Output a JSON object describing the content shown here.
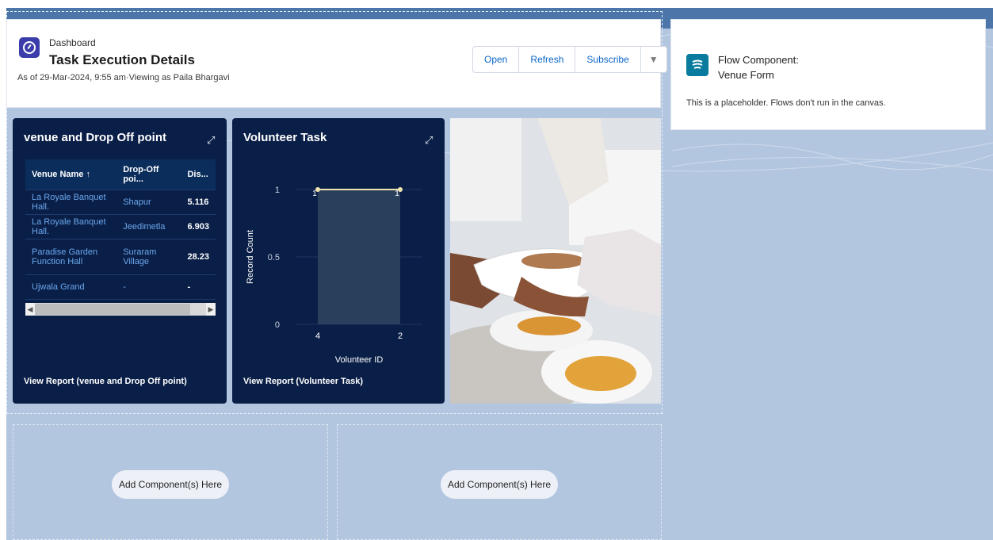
{
  "header": {
    "eyebrow": "Dashboard",
    "title": "Task Execution Details",
    "subtitle": "As of 29-Mar-2024, 9:55 am·Viewing as Paila Bhargavi",
    "buttons": {
      "open": "Open",
      "refresh": "Refresh",
      "subscribe": "Subscribe",
      "menu": "▼"
    }
  },
  "venue_panel": {
    "title": "venue and Drop Off point",
    "expand": "⤢",
    "columns": [
      "Venue Name ↑",
      "Drop-Off poi...",
      "Dis..."
    ],
    "rows": [
      [
        "La Royale Banquet Hall.",
        "Shapur",
        "5.116"
      ],
      [
        "La Royale Banquet Hall.",
        "Jeedimetla",
        "6.903"
      ],
      [
        "Paradise Garden Function Hall",
        "Suraram Village",
        "28.23"
      ],
      [
        "Ujwala Grand",
        "-",
        "-"
      ]
    ],
    "view_report": "View Report (venue and Drop Off point)"
  },
  "volunteer_panel": {
    "title": "Volunteer Task",
    "expand": "⤢",
    "view_report": "View Report (Volunteer Task)"
  },
  "chart_data": {
    "type": "bar",
    "title": "Volunteer Task",
    "categories": [
      "4",
      "2"
    ],
    "values": [
      1,
      1
    ],
    "line_points": [
      1,
      1
    ],
    "xlabel": "Volunteer ID",
    "ylabel": "Record Count",
    "ylim": [
      0,
      1
    ],
    "yticks": [
      "1",
      "0.5",
      "0"
    ],
    "colors": {
      "bar": "#2a3f5c",
      "line": "#f2e6b0"
    }
  },
  "flow": {
    "title_line1": "Flow Component:",
    "title_line2": "Venue Form",
    "note": "This is a placeholder. Flows don't run in the canvas."
  },
  "dropzones": {
    "left": "Add Component(s) Here",
    "right": "Add Component(s) Here"
  },
  "colors": {
    "panel": "#0a1f47",
    "accent": "#0a66c9",
    "canvas": "#b3c6e0"
  }
}
